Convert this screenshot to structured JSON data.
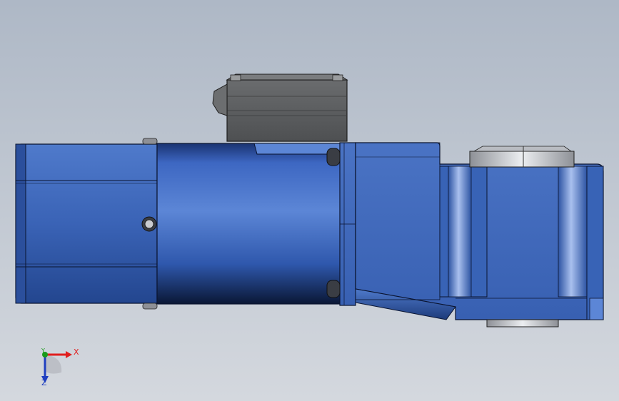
{
  "viewport": {
    "background_top": "#aeb8c6",
    "background_bottom": "#d4d8de"
  },
  "model": {
    "body_color": "#3a66c0",
    "body_dark": "#0e1f45",
    "body_light": "#6f95df",
    "terminal_box_color": "#5e6062",
    "metal_color": "#c9cbcf"
  },
  "triad": {
    "x_label": "X",
    "y_label": "Y",
    "z_label": "Z",
    "x_color": "#e01e1e",
    "y_color": "#1a9a1a",
    "z_color": "#1f3fc0"
  }
}
